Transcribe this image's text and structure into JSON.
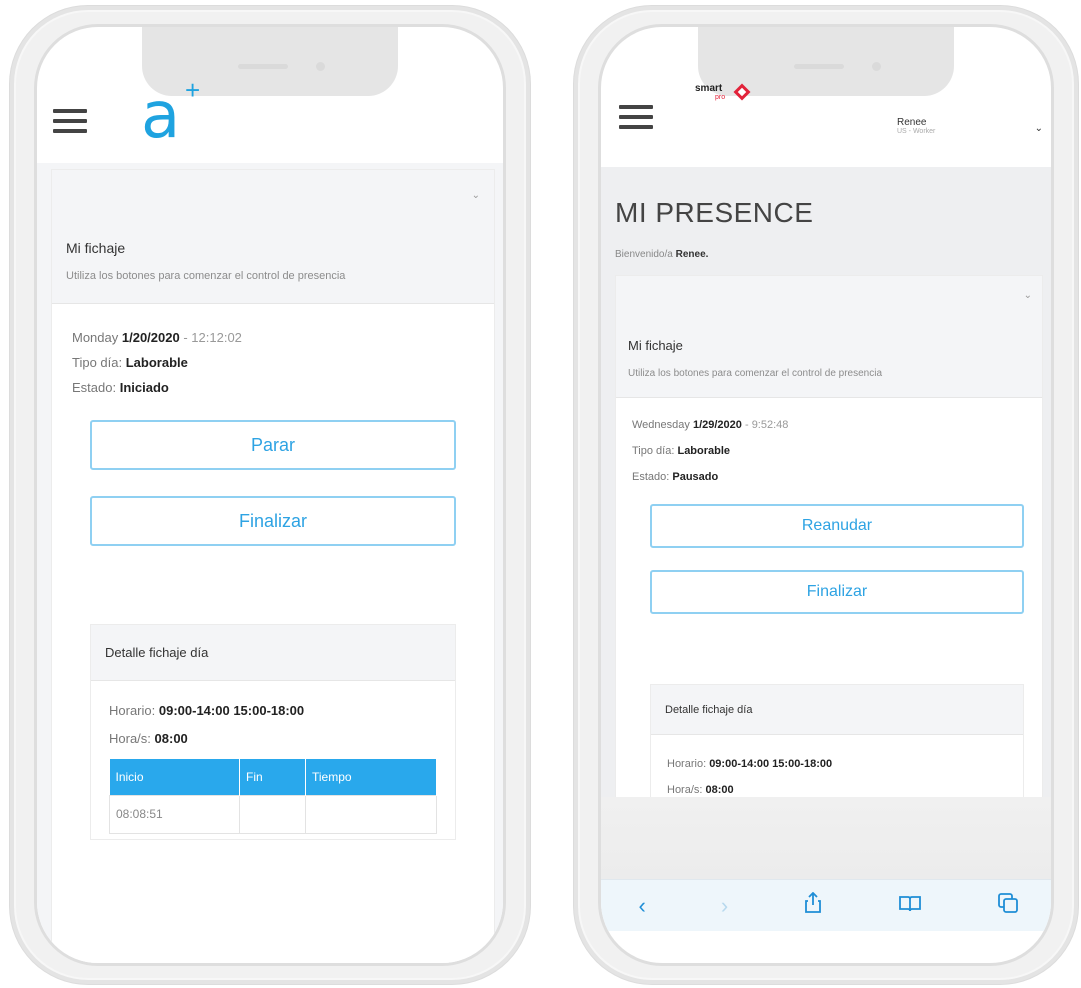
{
  "left_phone": {
    "logo_letter": "a",
    "logo_plus": "+",
    "card": {
      "title": "Mi fichaje",
      "subtitle": "Utiliza los botones para comenzar el control de presencia",
      "caret": "⌄"
    },
    "day_name": "Monday",
    "date": "1/20/2020",
    "time": "12:12:02",
    "tipo_label": "Tipo día:",
    "tipo_value": "Laborable",
    "estado_label": "Estado:",
    "estado_value": "Iniciado",
    "primary_button": "Parar",
    "finish_button": "Finalizar",
    "detail": {
      "title": "Detalle fichaje día",
      "horario_label": "Horario:",
      "horario_value": "09:00-14:00 15:00-18:00",
      "horas_label": "Hora/s:",
      "horas_value": "08:00",
      "table": {
        "headers": [
          "Inicio",
          "Fin",
          "Tiempo"
        ],
        "rows": [
          [
            "08:08:51",
            "",
            ""
          ]
        ]
      }
    }
  },
  "right_phone": {
    "brand_text": "smart",
    "brand_sub": "pro",
    "user_name": "Renee",
    "user_role": "US - Worker",
    "page_title": "MI PRESENCE",
    "welcome_text": "Bienvenido/a",
    "welcome_name": "Renee.",
    "card": {
      "title": "Mi fichaje",
      "subtitle": "Utiliza los botones para comenzar el control de presencia",
      "caret": "⌄"
    },
    "day_name": "Wednesday",
    "date": "1/29/2020",
    "time": "9:52:48",
    "tipo_label": "Tipo día:",
    "tipo_value": "Laborable",
    "estado_label": "Estado:",
    "estado_value": "Pausado",
    "primary_button": "Reanudar",
    "finish_button": "Finalizar",
    "detail": {
      "title": "Detalle fichaje día",
      "horario_label": "Horario:",
      "horario_value": "09:00-14:00 15:00-18:00",
      "horas_label": "Hora/s:",
      "horas_value": "08:00"
    },
    "safari_icons": [
      "back-icon",
      "forward-icon",
      "share-icon",
      "bookmarks-icon",
      "tabs-icon"
    ]
  },
  "colors": {
    "accent": "#2ea3e3",
    "button_border": "#8fd0f2",
    "table_header": "#29a8ec",
    "brand_red": "#e2233a"
  }
}
